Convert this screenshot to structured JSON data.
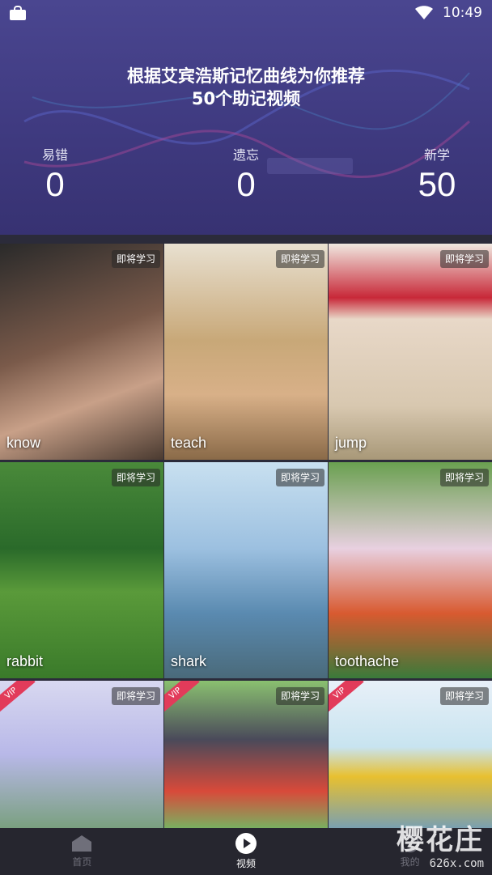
{
  "status_bar": {
    "time": "10:49"
  },
  "header": {
    "headline_line1": "根据艾宾浩斯记忆曲线为你推荐",
    "headline_line2": "50个助记视频",
    "stats": [
      {
        "label": "易错",
        "value": "0"
      },
      {
        "label": "遗忘",
        "value": "0"
      },
      {
        "label": "新学",
        "value": "50"
      }
    ]
  },
  "videos": [
    {
      "word": "know",
      "badge": "即将学习",
      "vip": false,
      "color": "#7a5a4a"
    },
    {
      "word": "teach",
      "badge": "即将学习",
      "vip": false,
      "color": "#c8a878"
    },
    {
      "word": "jump",
      "badge": "即将学习",
      "vip": false,
      "color": "#d8c8b0"
    },
    {
      "word": "rabbit",
      "badge": "即将学习",
      "vip": false,
      "color": "#4a8a3a"
    },
    {
      "word": "shark",
      "badge": "即将学习",
      "vip": false,
      "color": "#9cc0e0"
    },
    {
      "word": "toothache",
      "badge": "即将学习",
      "vip": false,
      "color": "#5a9a4a"
    },
    {
      "word": "",
      "badge": "即将学习",
      "vip": true,
      "vip_label": "VIP",
      "color": "#b8b8e8"
    },
    {
      "word": "",
      "badge": "即将学习",
      "vip": true,
      "vip_label": "VIP",
      "color": "#7ab060"
    },
    {
      "word": "",
      "badge": "即将学习",
      "vip": true,
      "vip_label": "VIP",
      "color": "#c8e4f0"
    }
  ],
  "tabbar": {
    "tabs": [
      {
        "label": "首页",
        "icon": "home-icon",
        "active": false
      },
      {
        "label": "视频",
        "icon": "play-icon",
        "active": true
      },
      {
        "label": "我的",
        "icon": "profile-icon",
        "active": false
      }
    ]
  },
  "watermark": {
    "main": "樱花庄",
    "sub": "626x.com"
  }
}
